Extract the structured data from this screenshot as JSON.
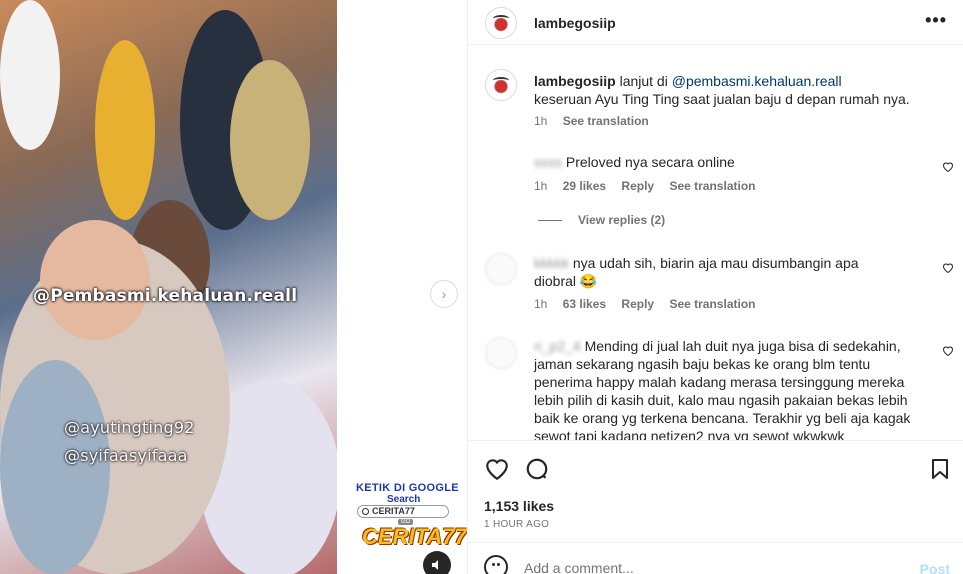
{
  "media": {
    "overlay_handle": "@Pembasmi.kehaluan.reall",
    "overlay_tag1": "@ayutingting92",
    "overlay_tag2": "@syifaasyifaaa"
  },
  "ad": {
    "line1": "KETIK DI GOOGLE",
    "line2": "Search",
    "search_value": "CERITA77",
    "go_label": "GO",
    "brand": "CERITA77"
  },
  "header": {
    "username": "lambegosiip",
    "more_icon": "more-horizontal-icon"
  },
  "caption": {
    "username": "lambegosiip",
    "text_prefix": "lanjut di",
    "mention": "@pembasmi.kehaluan.reall",
    "line2": "keseruan Ayu Ting Ting saat jualan baju d depan rumah nya.",
    "time": "1h",
    "see_translation": "See translation"
  },
  "comments": [
    {
      "username_blurred": "ssss",
      "text": "Preloved nya secara online",
      "time": "1h",
      "likes": "29 likes",
      "reply": "Reply",
      "see_translation": "See translation"
    },
    {
      "username_blurred": "kkkkk",
      "text": "nya udah sih, biarin aja mau disumbangin apa",
      "text2": "diobral 😂",
      "time": "1h",
      "likes": "63 likes",
      "reply": "Reply",
      "see_translation": "See translation"
    },
    {
      "username_blurred": "n_p2_4",
      "text": "Mending di jual lah duit nya juga bisa di sedekahin,",
      "lines": [
        "jaman sekarang ngasih baju bekas ke orang blm tentu",
        "penerima happy malah kadang merasa tersinggung mereka",
        "lebih pilih di kasih duit, kalo mau ngasih pakaian bekas lebih",
        "baik ke orang yg terkena bencana. Terakhir yg beli aja kagak",
        "sewot tapi kadang netizen2 nya yg sewot wkwkwk"
      ]
    }
  ],
  "view_replies": "View replies (2)",
  "actions": {
    "likes": "1,153 likes",
    "time": "1 HOUR AGO"
  },
  "add_comment": {
    "placeholder": "Add a comment...",
    "post_label": "Post"
  }
}
